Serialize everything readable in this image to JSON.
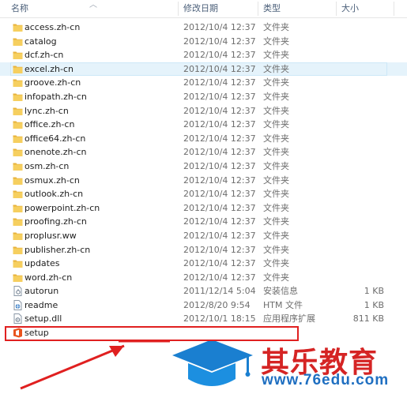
{
  "header": {
    "name": "名称",
    "date": "修改日期",
    "type": "类型",
    "size": "大小"
  },
  "files": [
    {
      "name": "access.zh-cn",
      "date": "2012/10/4 12:37",
      "type": "文件夹",
      "size": "",
      "icon": "folder-icon"
    },
    {
      "name": "catalog",
      "date": "2012/10/4 12:37",
      "type": "文件夹",
      "size": "",
      "icon": "folder-icon"
    },
    {
      "name": "dcf.zh-cn",
      "date": "2012/10/4 12:37",
      "type": "文件夹",
      "size": "",
      "icon": "folder-icon"
    },
    {
      "name": "excel.zh-cn",
      "date": "2012/10/4 12:37",
      "type": "文件夹",
      "size": "",
      "icon": "folder-icon",
      "selected": true
    },
    {
      "name": "groove.zh-cn",
      "date": "2012/10/4 12:37",
      "type": "文件夹",
      "size": "",
      "icon": "folder-icon"
    },
    {
      "name": "infopath.zh-cn",
      "date": "2012/10/4 12:37",
      "type": "文件夹",
      "size": "",
      "icon": "folder-icon"
    },
    {
      "name": "lync.zh-cn",
      "date": "2012/10/4 12:37",
      "type": "文件夹",
      "size": "",
      "icon": "folder-icon"
    },
    {
      "name": "office.zh-cn",
      "date": "2012/10/4 12:37",
      "type": "文件夹",
      "size": "",
      "icon": "folder-icon"
    },
    {
      "name": "office64.zh-cn",
      "date": "2012/10/4 12:37",
      "type": "文件夹",
      "size": "",
      "icon": "folder-icon"
    },
    {
      "name": "onenote.zh-cn",
      "date": "2012/10/4 12:37",
      "type": "文件夹",
      "size": "",
      "icon": "folder-icon"
    },
    {
      "name": "osm.zh-cn",
      "date": "2012/10/4 12:37",
      "type": "文件夹",
      "size": "",
      "icon": "folder-icon"
    },
    {
      "name": "osmux.zh-cn",
      "date": "2012/10/4 12:37",
      "type": "文件夹",
      "size": "",
      "icon": "folder-icon"
    },
    {
      "name": "outlook.zh-cn",
      "date": "2012/10/4 12:37",
      "type": "文件夹",
      "size": "",
      "icon": "folder-icon"
    },
    {
      "name": "powerpoint.zh-cn",
      "date": "2012/10/4 12:37",
      "type": "文件夹",
      "size": "",
      "icon": "folder-icon"
    },
    {
      "name": "proofing.zh-cn",
      "date": "2012/10/4 12:37",
      "type": "文件夹",
      "size": "",
      "icon": "folder-icon"
    },
    {
      "name": "proplusr.ww",
      "date": "2012/10/4 12:37",
      "type": "文件夹",
      "size": "",
      "icon": "folder-icon"
    },
    {
      "name": "publisher.zh-cn",
      "date": "2012/10/4 12:37",
      "type": "文件夹",
      "size": "",
      "icon": "folder-icon"
    },
    {
      "name": "updates",
      "date": "2012/10/4 12:37",
      "type": "文件夹",
      "size": "",
      "icon": "folder-icon"
    },
    {
      "name": "word.zh-cn",
      "date": "2012/10/4 12:37",
      "type": "文件夹",
      "size": "",
      "icon": "folder-icon"
    },
    {
      "name": "autorun",
      "date": "2011/12/14 5:04",
      "type": "安装信息",
      "size": "1 KB",
      "icon": "setup-info-file-icon"
    },
    {
      "name": "readme",
      "date": "2012/8/20 9:54",
      "type": "HTM 文件",
      "size": "1 KB",
      "icon": "htm-file-icon"
    },
    {
      "name": "setup.dll",
      "date": "2012/10/1 18:15",
      "type": "应用程序扩展",
      "size": "811 KB",
      "icon": "dll-file-icon"
    },
    {
      "name": "setup",
      "date": "",
      "type": "",
      "size": "",
      "icon": "office-setup-icon"
    }
  ],
  "watermark": {
    "brand": "其乐教育",
    "url": "www.76edu.com",
    "logo_icon": "graduation-cap-icon"
  },
  "colors": {
    "folder": "#f0c24b",
    "selection": "#e5f3fb",
    "highlight_box": "#e02020",
    "brand_red": "#d52424",
    "brand_blue": "#1f6fc1"
  }
}
